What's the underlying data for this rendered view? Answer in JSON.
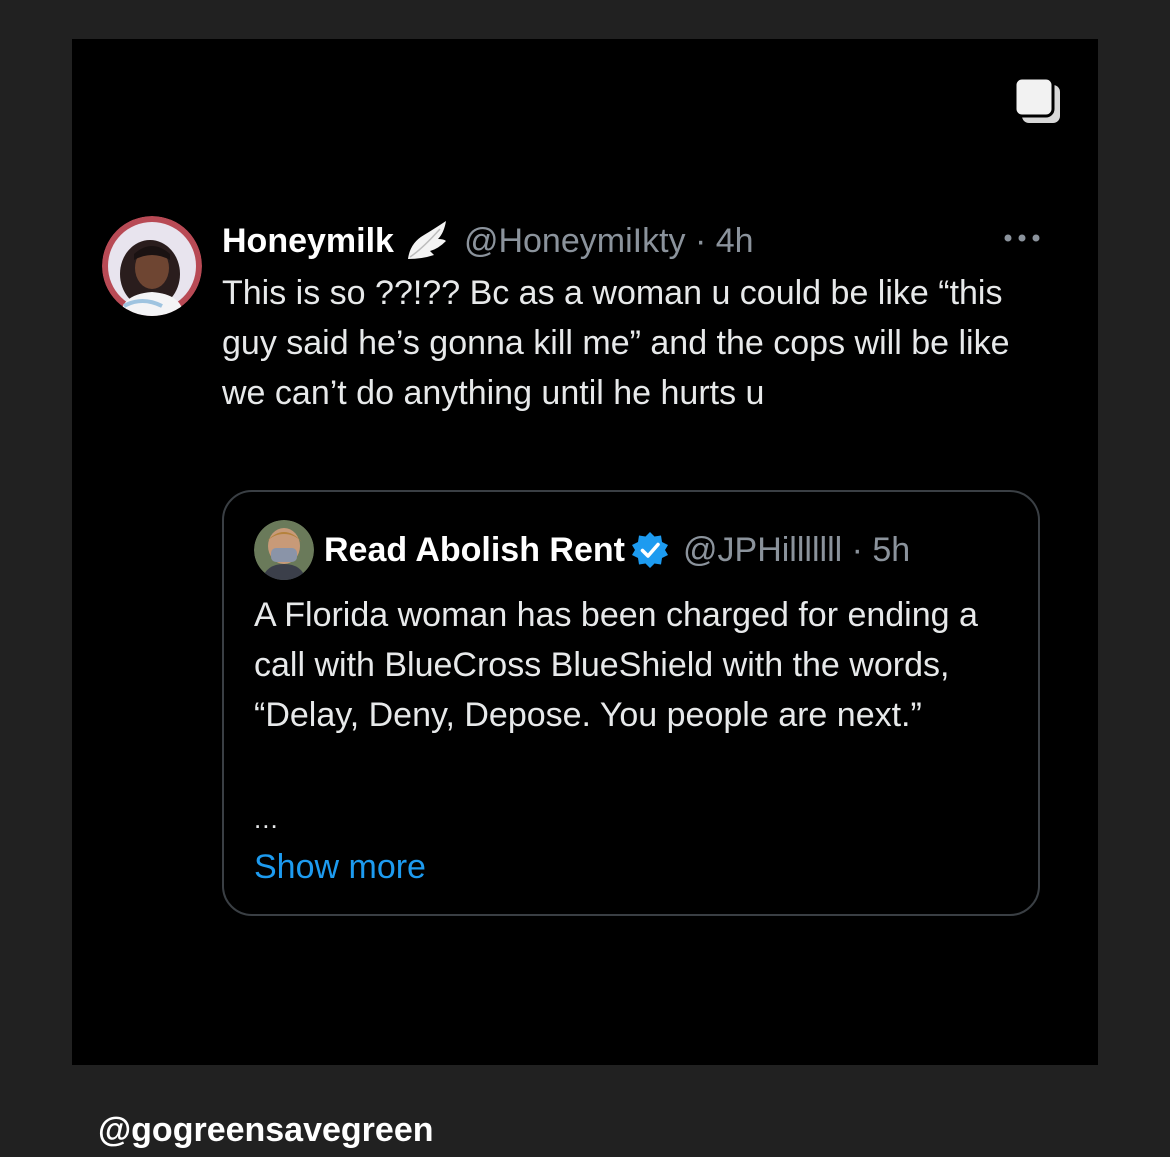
{
  "post": {
    "multi_image_icon": "stacked-squares-icon",
    "tweet": {
      "author_name": "Honeymilk",
      "author_badge_icon": "wing-icon",
      "handle_time": "@HoneymiIkty · 4h",
      "more_icon": "more-dots-icon",
      "text": "This is so ??!?? Bc as a woman u could be like “this guy said he’s gonna kill me” and the cops will be like we can’t do anything until he hurts u"
    },
    "quoted_tweet": {
      "author_name": "Read Abolish Rent",
      "verified_icon": "verified-badge-icon",
      "handle_time": "@JPHilllllll · 5h",
      "text": "A Florida woman has been charged for ending a call with BlueCross BlueShield with the words, “Delay, Deny, Depose. You people are next.”",
      "ellipsis": "...",
      "show_more_label": "Show more"
    }
  },
  "caption": "@gogreensavegreen",
  "colors": {
    "page_background": "#212121",
    "post_background": "#000000",
    "text_primary": "#e7e9ea",
    "text_secondary": "#8b939c",
    "link": "#1d9bf0",
    "verified": "#1d9bf0",
    "quote_border": "#3a3f44"
  }
}
